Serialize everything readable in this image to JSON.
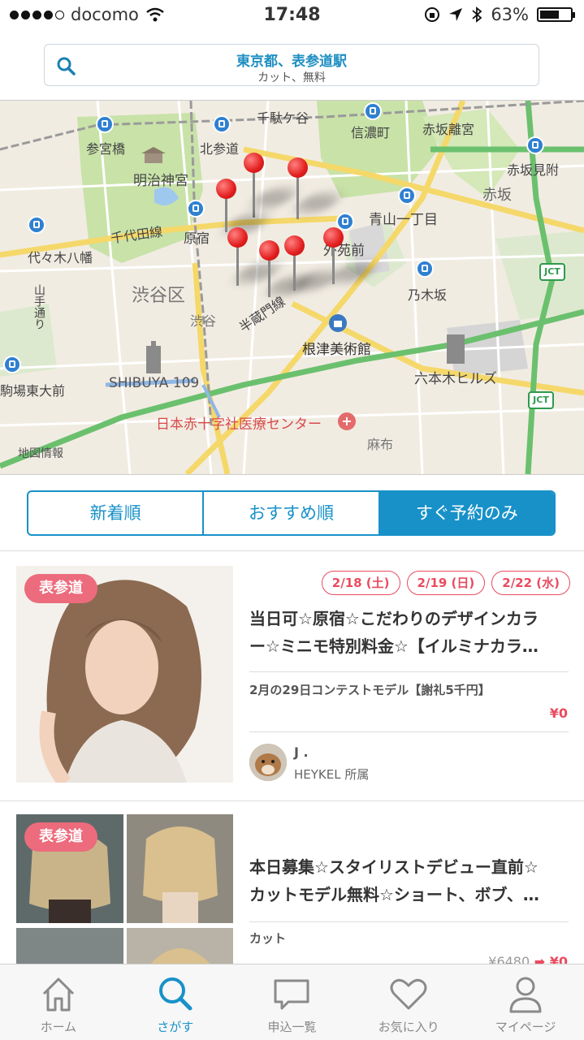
{
  "status_bar": {
    "carrier": "docomo",
    "time": "17:48",
    "battery": "63%",
    "battery_level": 0.63
  },
  "search": {
    "location": "東京都、表参道駅",
    "conditions": "カット、無料"
  },
  "map": {
    "labels": {
      "sendagaya": "千駄ケ谷",
      "shinanomachi": "信濃町",
      "akasaka_rikyu": "赤坂離宮",
      "sangubashi": "参宮橋",
      "kitasando": "北参道",
      "meiji_jingu": "明治神宮",
      "akasaka_mitsuke": "赤坂見附",
      "akasaka": "赤坂",
      "aoyama_itchome": "青山一丁目",
      "chiyoda_line": "千代田線",
      "harajuku": "原宿",
      "gaienmae": "外苑前",
      "yoyogi_hachiman": "代々木八幡",
      "nogizaka": "乃木坂",
      "shibuya_ku": "渋谷区",
      "shibuya": "渋谷",
      "hanzomon_line": "半蔵門線",
      "yamate_dori": "山手通り",
      "nezu_museum": "根津美術館",
      "roppongi_hills": "六本木ヒルズ",
      "higashi_daimae": "駒場東大前",
      "shibuya109": "SHIBUYA 109",
      "red_cross": "日本赤十字社医療センター",
      "azabu": "麻布",
      "map_info": "地図情報",
      "jct1": "JCT",
      "jct2": "JCT"
    }
  },
  "sort_tabs": [
    {
      "label": "新着順",
      "active": false
    },
    {
      "label": "おすすめ順",
      "active": false
    },
    {
      "label": "すぐ予約のみ",
      "active": true
    }
  ],
  "listings": [
    {
      "area": "表参道",
      "dates": [
        "2/18 (土)",
        "2/19 (日)",
        "2/22 (水)"
      ],
      "title_line1": "当日可☆原宿☆こだわりのデザインカラ",
      "title_line2": "ー☆ミニモ特別料金☆【イルミナカラ…",
      "menu": "2月の29日コンテストモデル【謝礼5千円】",
      "price": "¥0",
      "stylist_name": "J .",
      "stylist_shop": "HEYKEL 所属"
    },
    {
      "area": "表参道",
      "title_line1": "本日募集☆スタイリストデビュー直前☆",
      "title_line2": "カットモデル無料☆ショート、ボブ、…",
      "menu": "カット",
      "price_old": "¥6480",
      "price_arrow": "➡",
      "price": "¥0"
    }
  ],
  "tab_bar": [
    {
      "label": "ホーム",
      "icon": "home-icon",
      "active": false
    },
    {
      "label": "さがす",
      "icon": "search-icon",
      "active": true
    },
    {
      "label": "申込一覧",
      "icon": "chat-bubble-icon",
      "active": false
    },
    {
      "label": "お気に入り",
      "icon": "heart-icon",
      "active": false
    },
    {
      "label": "マイページ",
      "icon": "person-icon",
      "active": false
    }
  ],
  "colors": {
    "accent": "#1891c9",
    "badge": "#ec6b7c",
    "price": "#e94b5f"
  }
}
